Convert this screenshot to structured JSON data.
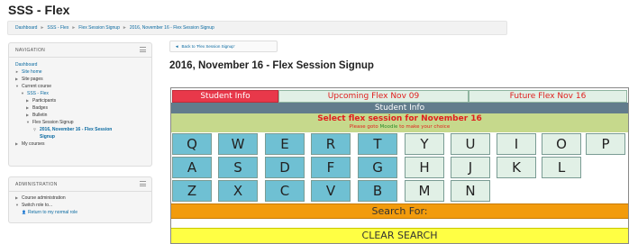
{
  "header": {
    "site_title": "SSS - Flex",
    "breadcrumb": [
      "Dashboard",
      "SSS - Flex",
      "Flex Session Signup",
      "2016, November 16 - Flex Session Signup"
    ]
  },
  "navigation": {
    "title": "NAVIGATION",
    "items": [
      {
        "label": "Dashboard"
      },
      {
        "label": "Site home"
      },
      {
        "label": "Site pages"
      },
      {
        "label": "Current course"
      },
      {
        "label": "SSS - Flex"
      },
      {
        "label": "Participants"
      },
      {
        "label": "Badges"
      },
      {
        "label": "Bulletin"
      },
      {
        "label": "Flex Session Signup"
      },
      {
        "label": "2016, November 16 - Flex Session"
      },
      {
        "label": "Signup"
      },
      {
        "label": "My courses"
      }
    ]
  },
  "administration": {
    "title": "ADMINISTRATION",
    "items": [
      {
        "label": "Course administration"
      },
      {
        "label": "Switch role to..."
      },
      {
        "label": "Return to my normal role"
      }
    ]
  },
  "main": {
    "back_link": "Back to 'Flex Session Signup'",
    "heading": "2016, November 16 - Flex Session Signup"
  },
  "signup": {
    "tabs": [
      "Student Info",
      "Upcoming Flex Nov 09",
      "Future Flex Nov 16"
    ],
    "info_bar": "Student Info",
    "select_text": "Select flex session for November 16",
    "goto_prefix": "Please goto ",
    "goto_link": "Moodle",
    "goto_suffix": " to make your choice",
    "keys_row1": [
      "Q",
      "W",
      "E",
      "R",
      "T",
      "Y",
      "U",
      "I",
      "O",
      "P"
    ],
    "keys_row2": [
      "A",
      "S",
      "D",
      "F",
      "G",
      "H",
      "J",
      "K",
      "L"
    ],
    "keys_row3": [
      "Z",
      "X",
      "C",
      "V",
      "B",
      "M",
      "N"
    ],
    "search_label": "Search For:",
    "clear_label": "CLEAR SEARCH"
  },
  "colors": {
    "tab_active": "#e8384a",
    "tab_inactive": "#e1f0e6",
    "info_bar": "#627c8c",
    "select_bar": "#c6d98c",
    "select_text": "#e0201f",
    "key_left": "#6fc0d3",
    "key_right": "#e1f0e6",
    "search_bar": "#f29b0c",
    "clear_bar": "#ffff44"
  }
}
